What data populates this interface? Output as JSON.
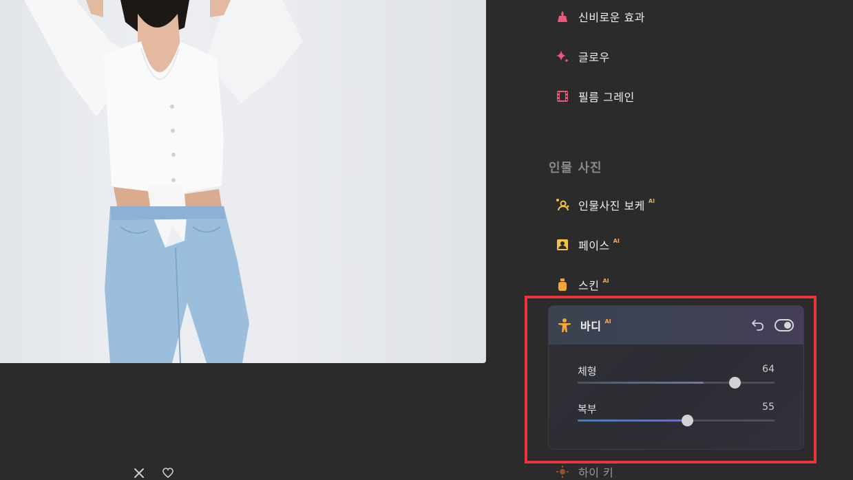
{
  "menu": {
    "items": [
      {
        "label": "신비로운 효과",
        "icon": "mystic-effect-icon",
        "ai": ""
      },
      {
        "label": "글로우",
        "icon": "sparkle-icon",
        "ai": ""
      },
      {
        "label": "필름 그레인",
        "icon": "film-icon",
        "ai": ""
      }
    ]
  },
  "portrait": {
    "section_title": "인물 사진",
    "items": [
      {
        "label": "인물사진 보케",
        "icon": "portrait-bokeh-icon",
        "ai": "AI"
      },
      {
        "label": "페이스",
        "icon": "face-icon",
        "ai": "AI"
      },
      {
        "label": "스킨",
        "icon": "skin-bottle-icon",
        "ai": "AI"
      }
    ],
    "next_item": {
      "label": "하이 키",
      "icon": "high-key-icon"
    }
  },
  "body_panel": {
    "title": "바디",
    "ai": "AI",
    "enabled": true,
    "sliders": [
      {
        "label": "체형",
        "value": "64",
        "fraction": 0.64
      },
      {
        "label": "복부",
        "value": "55",
        "fraction": 0.55
      }
    ]
  },
  "colors": {
    "accent_red": "#e8363c",
    "ai_badge": "#f2a65a",
    "body_icon": "#f4a53b",
    "portrait_icon": "#f2c24a"
  }
}
